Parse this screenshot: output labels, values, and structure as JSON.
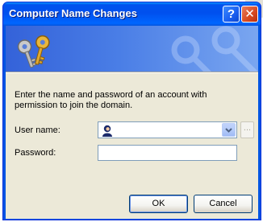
{
  "window": {
    "title": "Computer Name Changes",
    "help_glyph": "?",
    "close_glyph": "✕"
  },
  "banner": {
    "icon": "keys-icon"
  },
  "instructions": "Enter the name and password of an account with permission to join the domain.",
  "form": {
    "username_label": "User name:",
    "username_value": "",
    "username_icon": "user-icon",
    "password_label": "Password:",
    "password_value": "",
    "browse_label": "..."
  },
  "buttons": {
    "ok": "OK",
    "cancel": "Cancel"
  },
  "colors": {
    "titlebar": "#0054e3",
    "dialog_face": "#ece9d8",
    "banner": "#4a7ee6"
  }
}
